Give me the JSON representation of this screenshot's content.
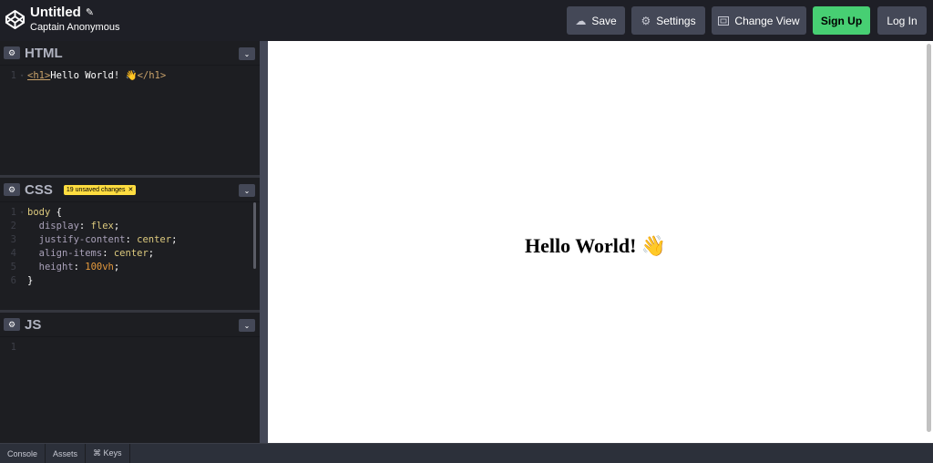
{
  "header": {
    "title": "Untitled",
    "edit_icon": "pencil-icon",
    "author": "Captain Anonymous",
    "buttons": {
      "save": "Save",
      "settings": "Settings",
      "change_view": "Change View",
      "sign_up": "Sign Up",
      "log_in": "Log In"
    }
  },
  "colors": {
    "signup_bg": "#47cf73",
    "badge_bg": "#ffdd40",
    "button_bg": "#444857"
  },
  "editors": {
    "html": {
      "title": "HTML",
      "lines": [
        {
          "n": "1",
          "open": "<h1>",
          "text": "Hello World! 👋",
          "close": "</h1>"
        }
      ]
    },
    "css": {
      "title": "CSS",
      "badge": "19 unsaved changes",
      "lines": [
        {
          "n": "1",
          "sel": "body",
          "punc": " {"
        },
        {
          "n": "2",
          "prop": "display",
          "val": "flex"
        },
        {
          "n": "3",
          "prop": "justify-content",
          "val": "center"
        },
        {
          "n": "4",
          "prop": "align-items",
          "val": "center"
        },
        {
          "n": "5",
          "prop": "height",
          "val": "100vh"
        },
        {
          "n": "6",
          "punc": "}"
        }
      ]
    },
    "js": {
      "title": "JS",
      "lines": [
        {
          "n": "1"
        }
      ]
    }
  },
  "preview": {
    "heading": "Hello World! 👋"
  },
  "footer": {
    "tabs": [
      "Console",
      "Assets",
      "⌘ Keys"
    ]
  }
}
